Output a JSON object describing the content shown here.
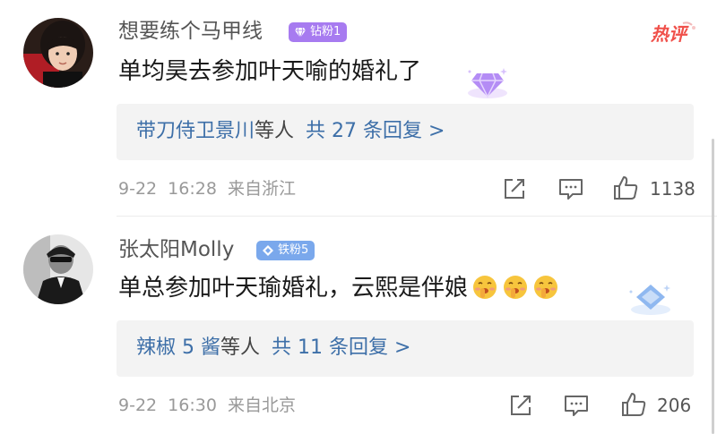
{
  "comments": [
    {
      "username": "想要练个马甲线",
      "badge": "钻粉1",
      "badge_color": "#a77bf0",
      "hot_label": "热评",
      "text": "单均昊去参加叶天喻的婚礼了",
      "reply_users": "带刀侍卫景川",
      "reply_mid": "等人",
      "reply_count": "共 27 条回复 >",
      "date": "9-22",
      "time": "16:28",
      "location": "来自浙江",
      "likes": "1138"
    },
    {
      "username": "张太阳Molly",
      "badge": "铁粉5",
      "badge_color": "#7aa8ec",
      "text": "单总参加叶天瑜婚礼，云熙是伴娘",
      "emojis": [
        "shush-emoji",
        "shush-emoji",
        "shush-emoji"
      ],
      "reply_users": "辣椒 5 酱",
      "reply_mid": "等人",
      "reply_count": "共 11 条回复 >",
      "date": "9-22",
      "time": "16:30",
      "location": "来自北京",
      "likes": "206"
    }
  ],
  "icons": [
    "share-icon",
    "comment-icon",
    "like-icon"
  ]
}
